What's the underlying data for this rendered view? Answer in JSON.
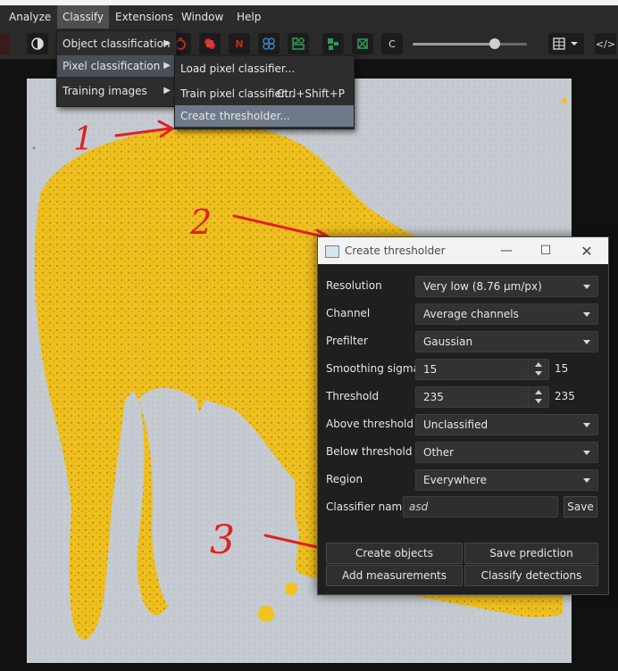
{
  "menubar": {
    "items": [
      {
        "label": "Analyze"
      },
      {
        "label": "Classify"
      },
      {
        "label": "Extensions"
      },
      {
        "label": "Window"
      },
      {
        "label": "Help"
      }
    ]
  },
  "toolbar": {
    "buttons": [
      {
        "icon": "contrast-icon"
      },
      {
        "icon": "points-icon"
      },
      {
        "icon": "annotations-icon"
      },
      {
        "icon": "n-label-icon",
        "text": "N"
      },
      {
        "icon": "detections-icon"
      },
      {
        "icon": "tma-grid-icon"
      },
      {
        "icon": "pixel-classification-icon"
      },
      {
        "icon": "selection-mode-icon"
      },
      {
        "icon": "c-label-icon",
        "text": "C"
      },
      {
        "icon": "table-icon"
      },
      {
        "icon": "code-icon",
        "text": "</>"
      }
    ],
    "opacity_slider_fraction": 0.72,
    "colors": {
      "red": "#c62828",
      "green": "#2e9b5a",
      "blue": "#3f7fc1"
    }
  },
  "classify_menu": {
    "items": [
      {
        "label": "Object classification",
        "submenu": true
      },
      {
        "label": "Pixel classification",
        "submenu": true
      },
      {
        "label": "Training images",
        "submenu": true
      }
    ]
  },
  "pixel_submenu": {
    "items": [
      {
        "label": "Load pixel classifier...",
        "accelerator": ""
      },
      {
        "label": "Train pixel classifier...",
        "accelerator": "Ctrl+Shift+P"
      },
      {
        "label": "Create thresholder...",
        "accelerator": ""
      }
    ]
  },
  "dialog": {
    "title": "Create thresholder",
    "titlebar_buttons": [
      "minimize",
      "maximize",
      "close"
    ],
    "rows": {
      "resolution": {
        "label": "Resolution",
        "value": "Very low (8.76 µm/px)"
      },
      "channel": {
        "label": "Channel",
        "value": "Average channels"
      },
      "prefilter": {
        "label": "Prefilter",
        "value": "Gaussian"
      },
      "smoothing": {
        "label": "Smoothing sigma",
        "value": "15",
        "display": "15"
      },
      "threshold": {
        "label": "Threshold",
        "value": "235",
        "display": "235"
      },
      "above": {
        "label": "Above threshold",
        "value": "Unclassified"
      },
      "below": {
        "label": "Below threshold",
        "value": "Other"
      },
      "region": {
        "label": "Region",
        "value": "Everywhere"
      },
      "classifier_name": {
        "label": "Classifier name",
        "value": "asd",
        "save": "Save"
      }
    },
    "buttons": {
      "create_objects": "Create objects",
      "save_prediction": "Save prediction",
      "add_measurements": "Add measurements",
      "classify_detections": "Classify detections"
    }
  },
  "annotations": {
    "numbers": [
      "1",
      "2",
      "3"
    ],
    "color": "#e02121"
  },
  "overlay_color": "#f2c31a"
}
